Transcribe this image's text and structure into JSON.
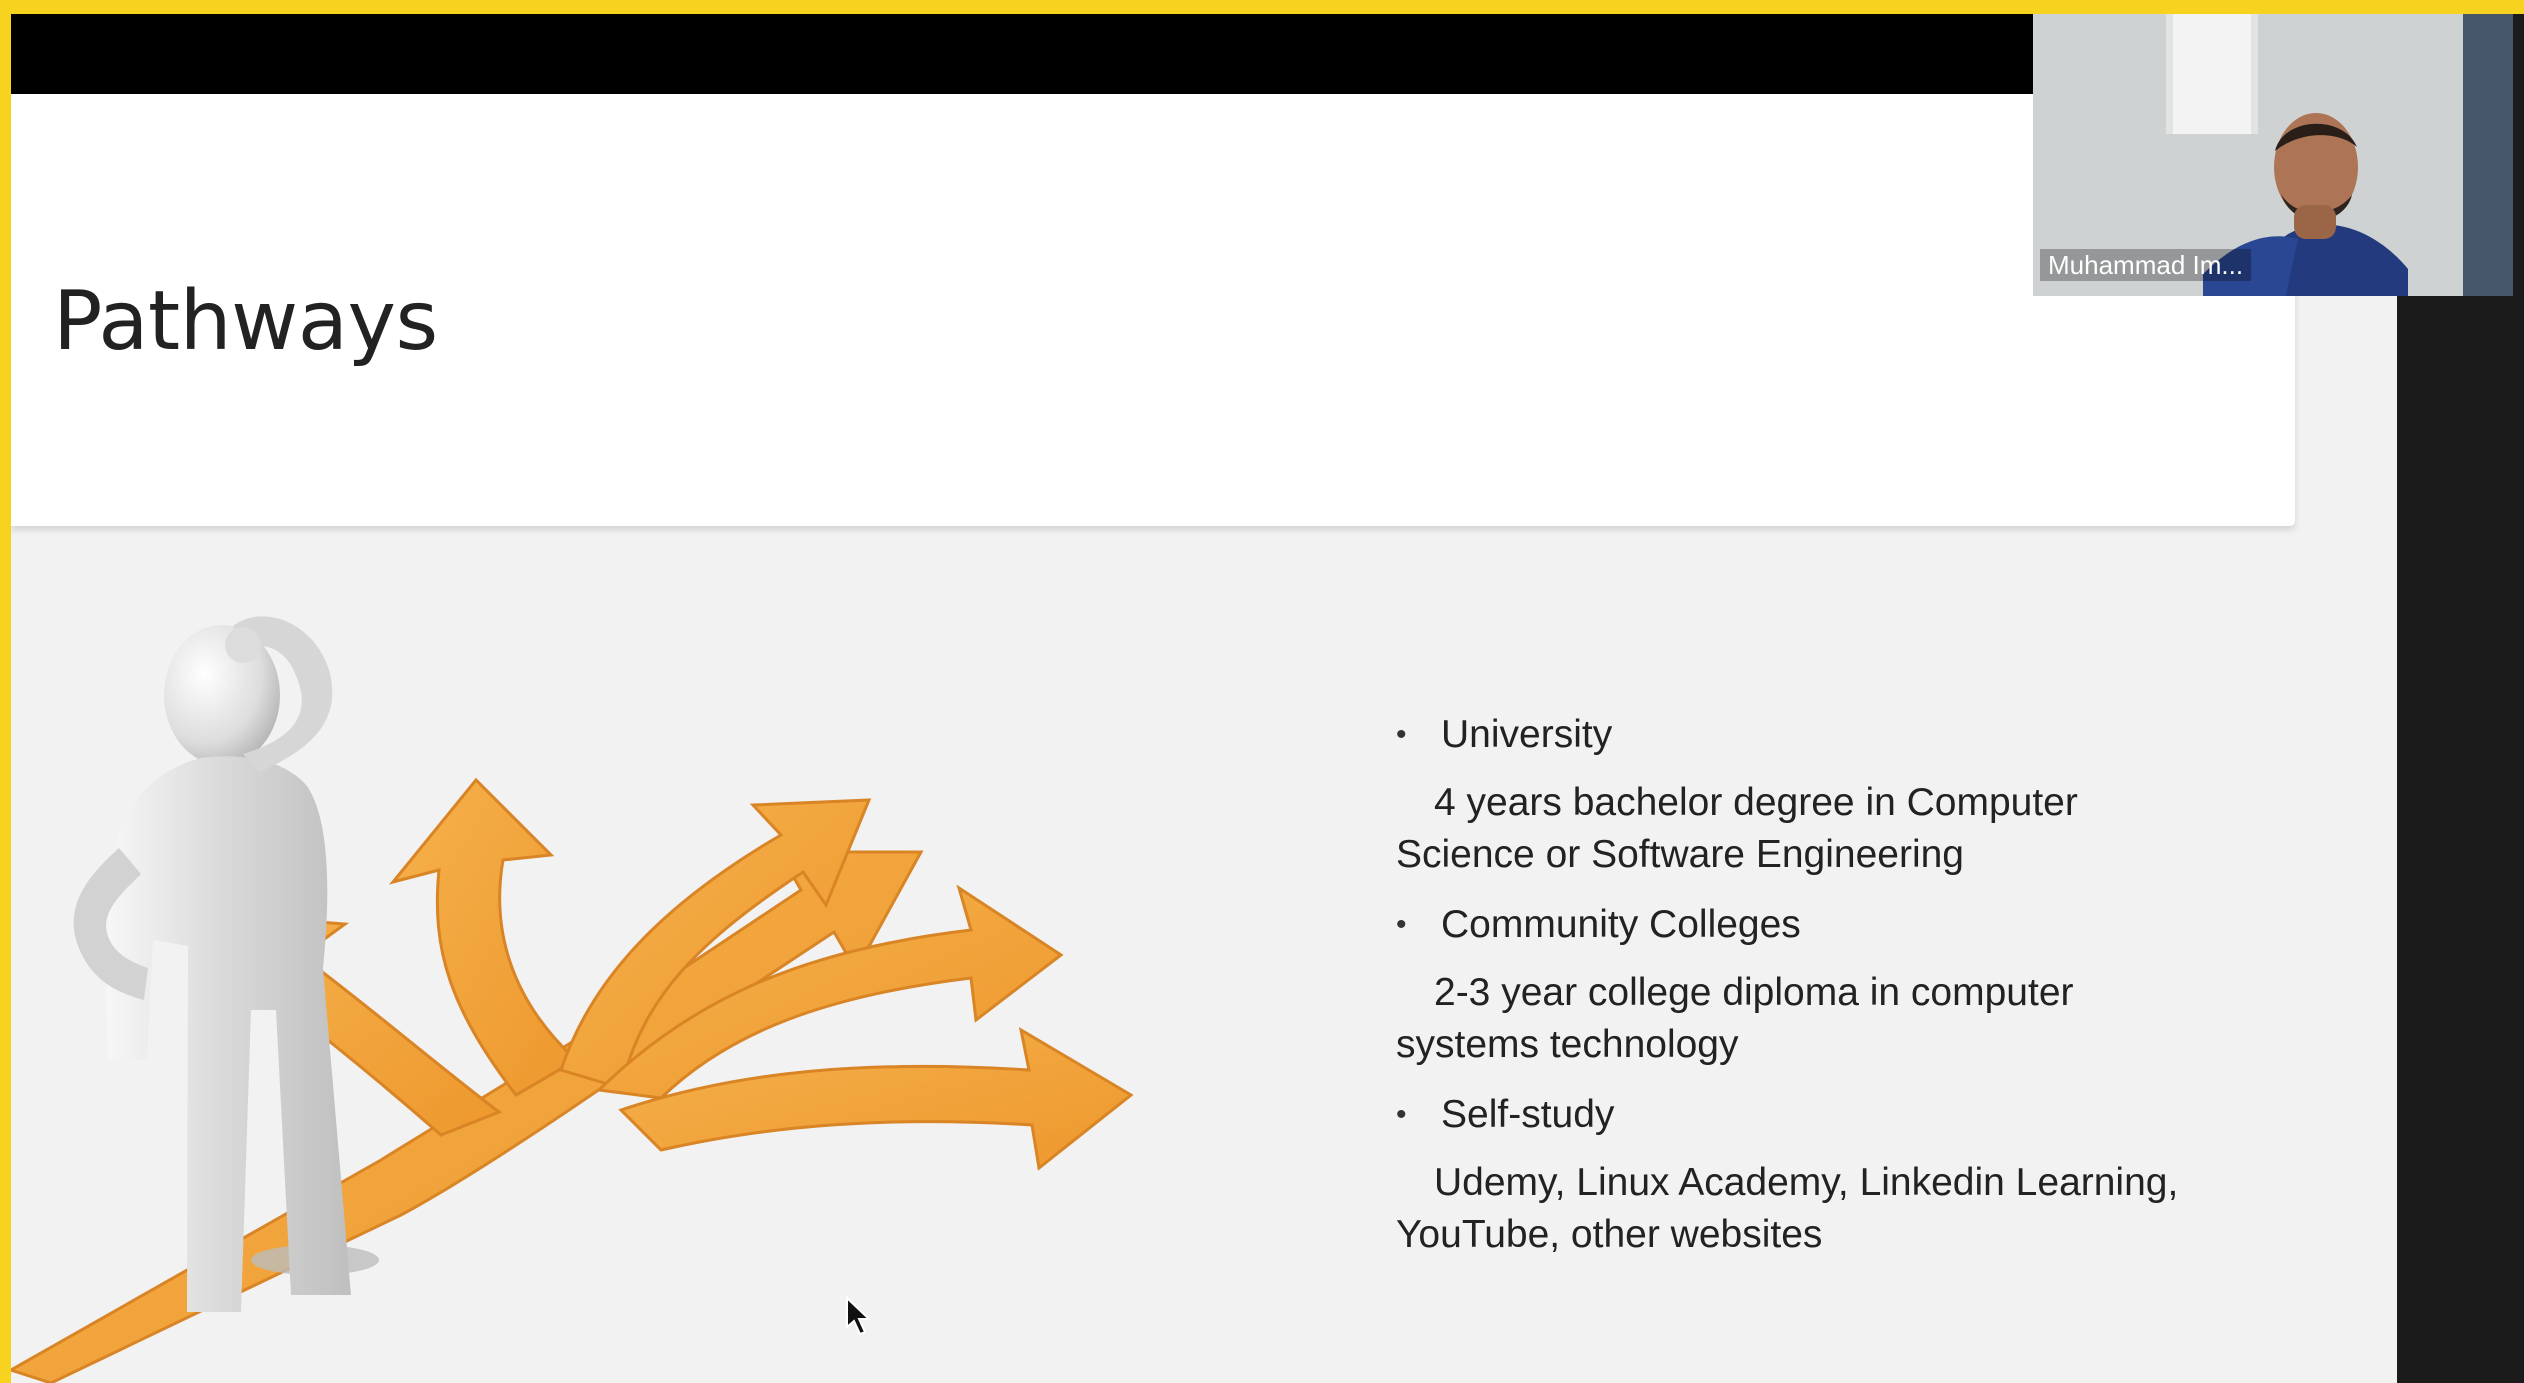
{
  "presentation": {
    "slide_title": "Pathways",
    "bullets": [
      {
        "title": "University",
        "detail": "4 years bachelor degree in Computer Science or Software Engineering"
      },
      {
        "title": "Community Colleges",
        "detail": "2-3 year college diploma in computer systems technology"
      },
      {
        "title": "Self-study",
        "detail": "Udemy, Linux Academy, Linkedin Learning, YouTube, other websites"
      }
    ],
    "bullet_symbol": "•"
  },
  "video": {
    "participant_name": "Muhammad Im..."
  },
  "icons": {
    "figure": "thinking-person-icon",
    "paths": "branching-arrows-icon",
    "cursor": "mouse-pointer-icon"
  },
  "colors": {
    "frame": "#f7d21e",
    "arrow": "#f2a43a",
    "slide_background": "#f2f2f2"
  }
}
